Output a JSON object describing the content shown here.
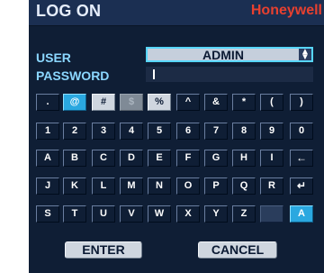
{
  "title": "LOG ON",
  "brand": "Honeywell",
  "user": {
    "label": "USER",
    "value": "ADMIN",
    "dropdown_icon": "up-down-arrows"
  },
  "password": {
    "label": "PASSWORD",
    "value": ""
  },
  "keyboard": {
    "rows": [
      [
        ".",
        "@",
        "#",
        "$",
        "%",
        "^",
        "&",
        "*",
        "(",
        ")"
      ],
      [
        "1",
        "2",
        "3",
        "4",
        "5",
        "6",
        "7",
        "8",
        "9",
        "0"
      ],
      [
        "A",
        "B",
        "C",
        "D",
        "E",
        "F",
        "G",
        "H",
        "I",
        "←"
      ],
      [
        "J",
        "K",
        "L",
        "M",
        "N",
        "O",
        "P",
        "Q",
        "R",
        "↵"
      ],
      [
        "S",
        "T",
        "U",
        "V",
        "W",
        "X",
        "Y",
        "Z",
        "",
        "A"
      ]
    ]
  },
  "buttons": {
    "enter": "ENTER",
    "cancel": "CANCEL"
  },
  "colors": {
    "panel": "#0f1e35",
    "key": "#cfd6df",
    "highlight": "#2aa8e0",
    "label": "#8bd7ff",
    "brand": "#e8402f"
  }
}
